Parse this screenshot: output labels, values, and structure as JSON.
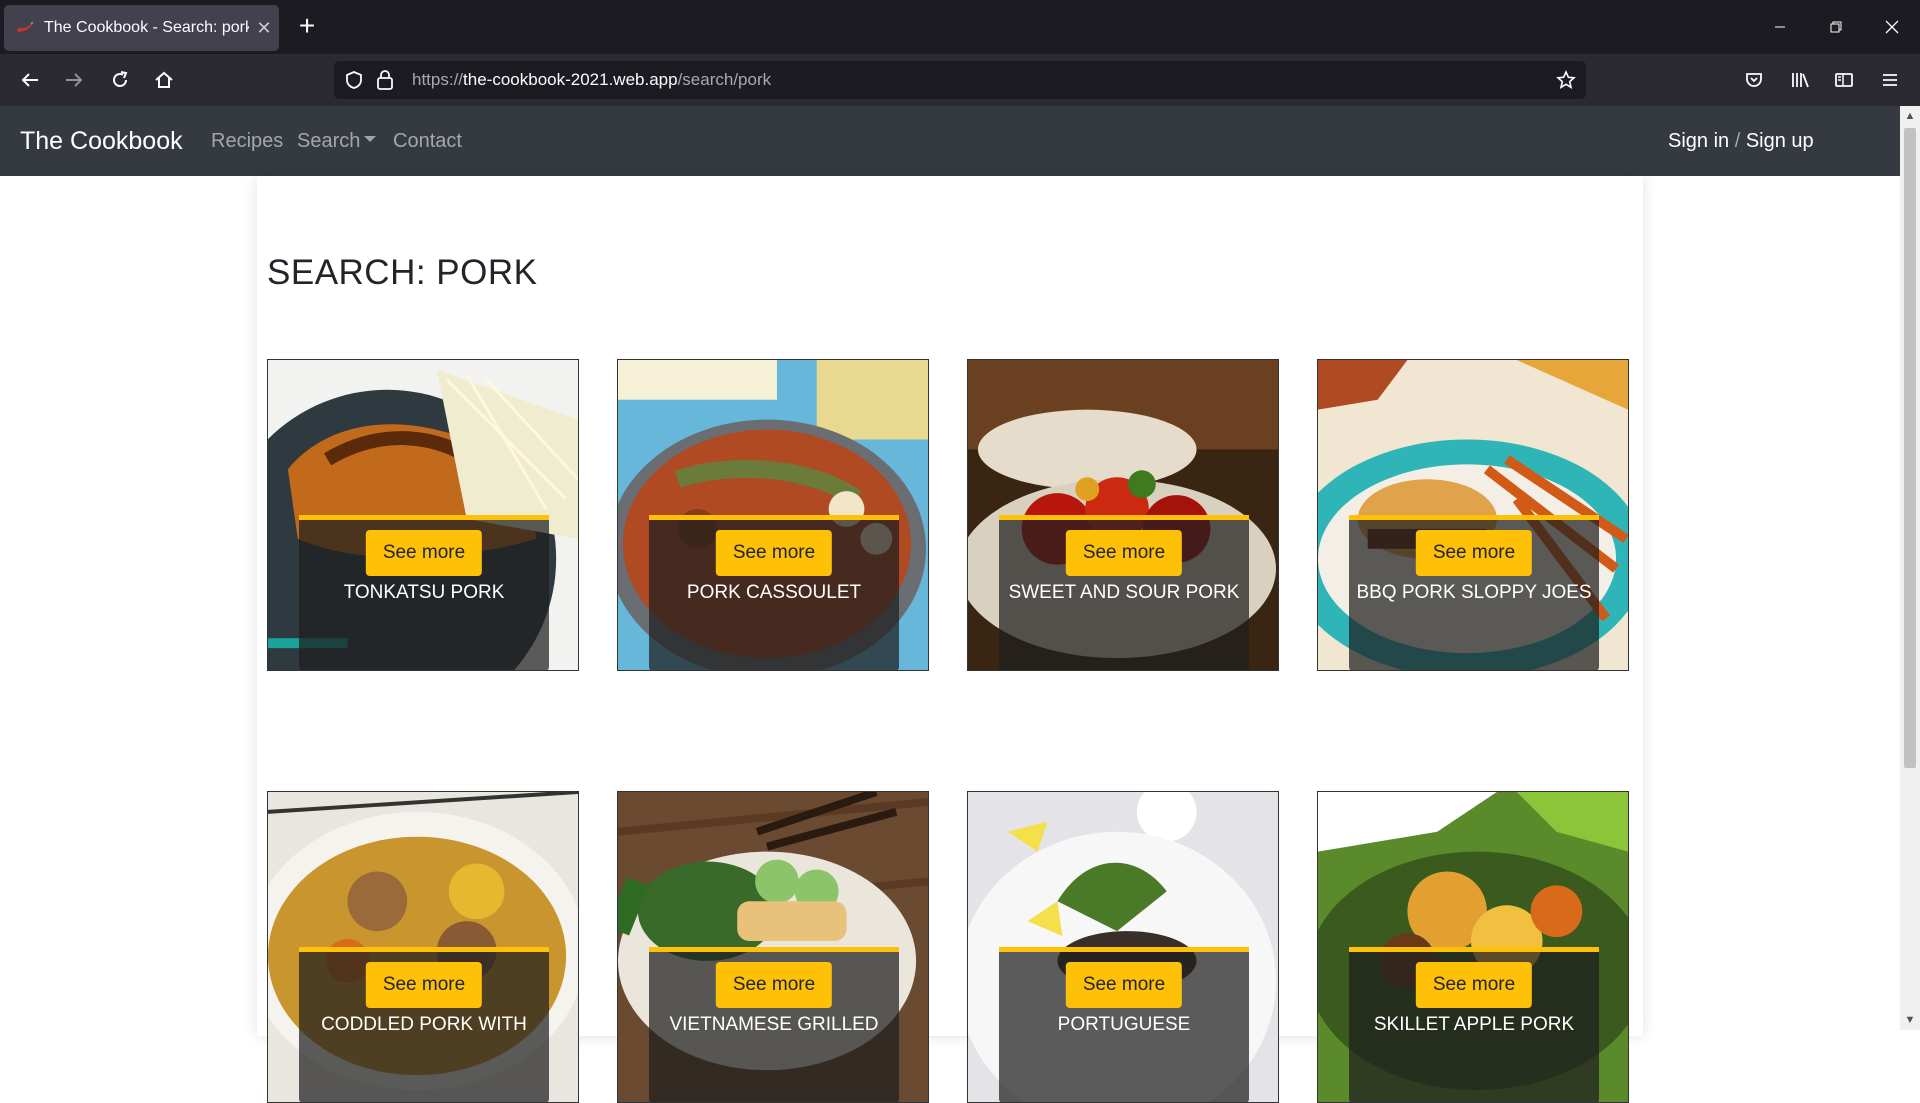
{
  "browser": {
    "tab_title": "The Cookbook - Search: pork",
    "new_tab": "+",
    "url_scheme": "https://",
    "url_host": "the-cookbook-2021.web.app",
    "url_path": "/search/pork"
  },
  "site": {
    "brand": "The Cookbook",
    "nav": {
      "recipes": "Recipes",
      "search": "Search",
      "contact": "Contact"
    },
    "signin": "Sign in",
    "separator": "/",
    "signup": "Sign up"
  },
  "page": {
    "heading": "SEARCH: PORK",
    "see_more": "See more",
    "recipes": [
      {
        "name": "Tonkatsu Pork",
        "image": "fried-pork-cutlet-with-cabbage"
      },
      {
        "name": "Pork Cassoulet",
        "image": "stew-in-pan"
      },
      {
        "name": "Sweet and Sour Pork",
        "image": "red-glazed-pork"
      },
      {
        "name": "BBQ Pork Sloppy Joes",
        "image": "sandwich-with-fries"
      },
      {
        "name": "Coddled Pork With",
        "image": "pork-stew-bowl"
      },
      {
        "name": "Vietnamese Grilled",
        "image": "spring-rolls-salad"
      },
      {
        "name": "Portuguese",
        "image": "grilled-pork-plate"
      },
      {
        "name": "Skillet Apple Pork",
        "image": "apple-pork-vegetables"
      }
    ]
  },
  "colors": {
    "accent": "#ffc107",
    "navbar": "#343a40",
    "chrome": "#1c1b22"
  }
}
